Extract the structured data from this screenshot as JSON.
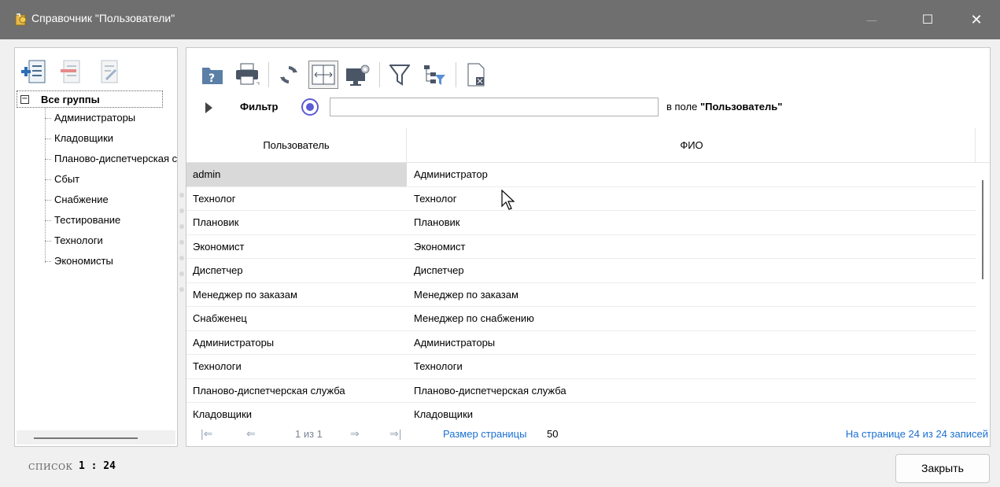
{
  "window": {
    "title": "Справочник \"Пользователи\"",
    "minimize_glyph": "—",
    "maximize_glyph": "☐",
    "close_glyph": "✕"
  },
  "left_toolbar": {
    "icons": [
      "add-group-icon",
      "remove-group-icon",
      "edit-group-icon"
    ]
  },
  "tree": {
    "expander": "−",
    "root_label": "Все группы",
    "items": [
      "Администраторы",
      "Кладовщики",
      "Планово-диспетчерская служба",
      "Сбыт",
      "Снабжение",
      "Тестирование",
      "Технологи",
      "Экономисты"
    ]
  },
  "toolbar": {
    "icons": [
      "help-icon",
      "print-icon",
      "refresh-icon",
      "fit-columns-icon",
      "display-settings-icon",
      "filter-icon",
      "tree-filter-icon",
      "export-icon"
    ]
  },
  "filter": {
    "label": "Фильтр",
    "value": "",
    "field_prefix": "в поле ",
    "field_name": "\"Пользователь\""
  },
  "grid": {
    "columns": [
      "Пользователь",
      "ФИО"
    ],
    "rows": [
      {
        "user": "admin",
        "fio": "Администратор"
      },
      {
        "user": "Технолог",
        "fio": "Технолог"
      },
      {
        "user": "Плановик",
        "fio": "Плановик"
      },
      {
        "user": "Экономист",
        "fio": "Экономист"
      },
      {
        "user": "Диспетчер",
        "fio": "Диспетчер"
      },
      {
        "user": "Менеджер по заказам",
        "fio": "Менеджер по заказам"
      },
      {
        "user": "Снабженец",
        "fio": "Менеджер по снабжению"
      },
      {
        "user": "Администраторы",
        "fio": "Администраторы"
      },
      {
        "user": "Технологи",
        "fio": "Технологи"
      },
      {
        "user": "Планово-диспетчерская служба",
        "fio": "Планово-диспетчерская служба"
      },
      {
        "user": "Кладовщики",
        "fio": "Кладовщики"
      }
    ]
  },
  "pager": {
    "first": "|⇐",
    "prev": "⇐",
    "page_text": "1 из 1",
    "next": "⇒",
    "last": "⇒|",
    "page_size_label": "Размер страницы",
    "page_size_value": "50",
    "records_text": "На странице 24 из 24 записей"
  },
  "status": {
    "mode": "СПИСОК",
    "count": "1 : 24"
  },
  "buttons": {
    "close": "Закрыть"
  }
}
